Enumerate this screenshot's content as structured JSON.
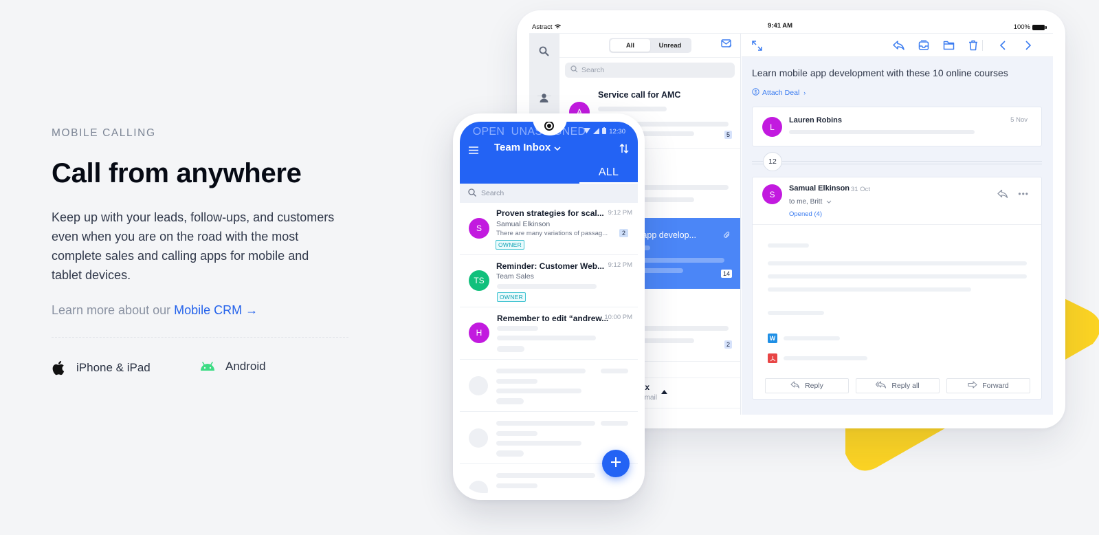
{
  "hero": {
    "eyebrow": "MOBILE CALLING",
    "headline": "Call from anywhere",
    "description": "Keep up with your leads, follow-ups, and customers even when you are on the road with the most complete sales and calling apps for mobile and tablet devices.",
    "learn_prefix": "Learn more about our ",
    "learn_link": "Mobile CRM",
    "learn_arrow": "→",
    "platforms": [
      {
        "label": "iPhone & iPad",
        "icon": "apple-icon"
      },
      {
        "label": "Android",
        "icon": "android-icon"
      }
    ]
  },
  "colors": {
    "accent": "#2563eb",
    "phone_header": "#2363f4",
    "selected_mail": "#4b86f7",
    "avatar_purple": "#c21adf",
    "avatar_green": "#11c07c",
    "decor_yellow": "#fbd324"
  },
  "tablet": {
    "status": {
      "carrier": "Astract",
      "time": "9:41 AM",
      "battery": "100%"
    },
    "list": {
      "segments": [
        "All",
        "Unread"
      ],
      "active_segment": "All",
      "search_placeholder": "Search",
      "items": [
        {
          "title": "Service call for AMC",
          "avatar": "A",
          "badge": "5"
        },
        {
          "title": "",
          "badge": ""
        },
        {
          "title": "e app develop...",
          "badge": "14",
          "selected": true,
          "has_attachment": true
        },
        {
          "title": "",
          "badge": "2"
        }
      ],
      "footer_label": "ox",
      "footer_sub": "Email"
    },
    "detail": {
      "subject": "Learn mobile app development with these 10 online courses",
      "attach_deal": "Attach Deal",
      "collapsed_message": {
        "sender": "Lauren Robins",
        "avatar": "L",
        "date": "5 Nov"
      },
      "thread_count": "12",
      "open_message": {
        "sender": "Samual Elkinson",
        "avatar": "S",
        "date": "31 Oct",
        "recipients": "to me, Britt",
        "opened": "Opened (4)",
        "attachments": [
          {
            "type": "word",
            "glyph": "W"
          },
          {
            "type": "pdf",
            "glyph": "⅄"
          }
        ]
      },
      "actions": [
        "Reply",
        "Reply all",
        "Forward"
      ]
    }
  },
  "phone": {
    "status_time": "12:30",
    "title": "Team Inbox",
    "tabs": [
      "OPEN",
      "UNASSIGNED",
      "ALL"
    ],
    "active_tab": "ALL",
    "search_placeholder": "Search",
    "items": [
      {
        "title": "Proven strategies for scal...",
        "from": "Samual Elkinson",
        "preview": "There are many variations of passag...",
        "time": "9:12 PM",
        "avatar": "S",
        "tag": "OWNER",
        "badge": "2"
      },
      {
        "title": "Reminder: Customer Web...",
        "from": "Team Sales",
        "time": "9:12 PM",
        "avatar": "TS",
        "tag": "OWNER"
      },
      {
        "title": "Remember to edit “andrew...",
        "time": "10:00 PM",
        "avatar": "H"
      }
    ]
  }
}
